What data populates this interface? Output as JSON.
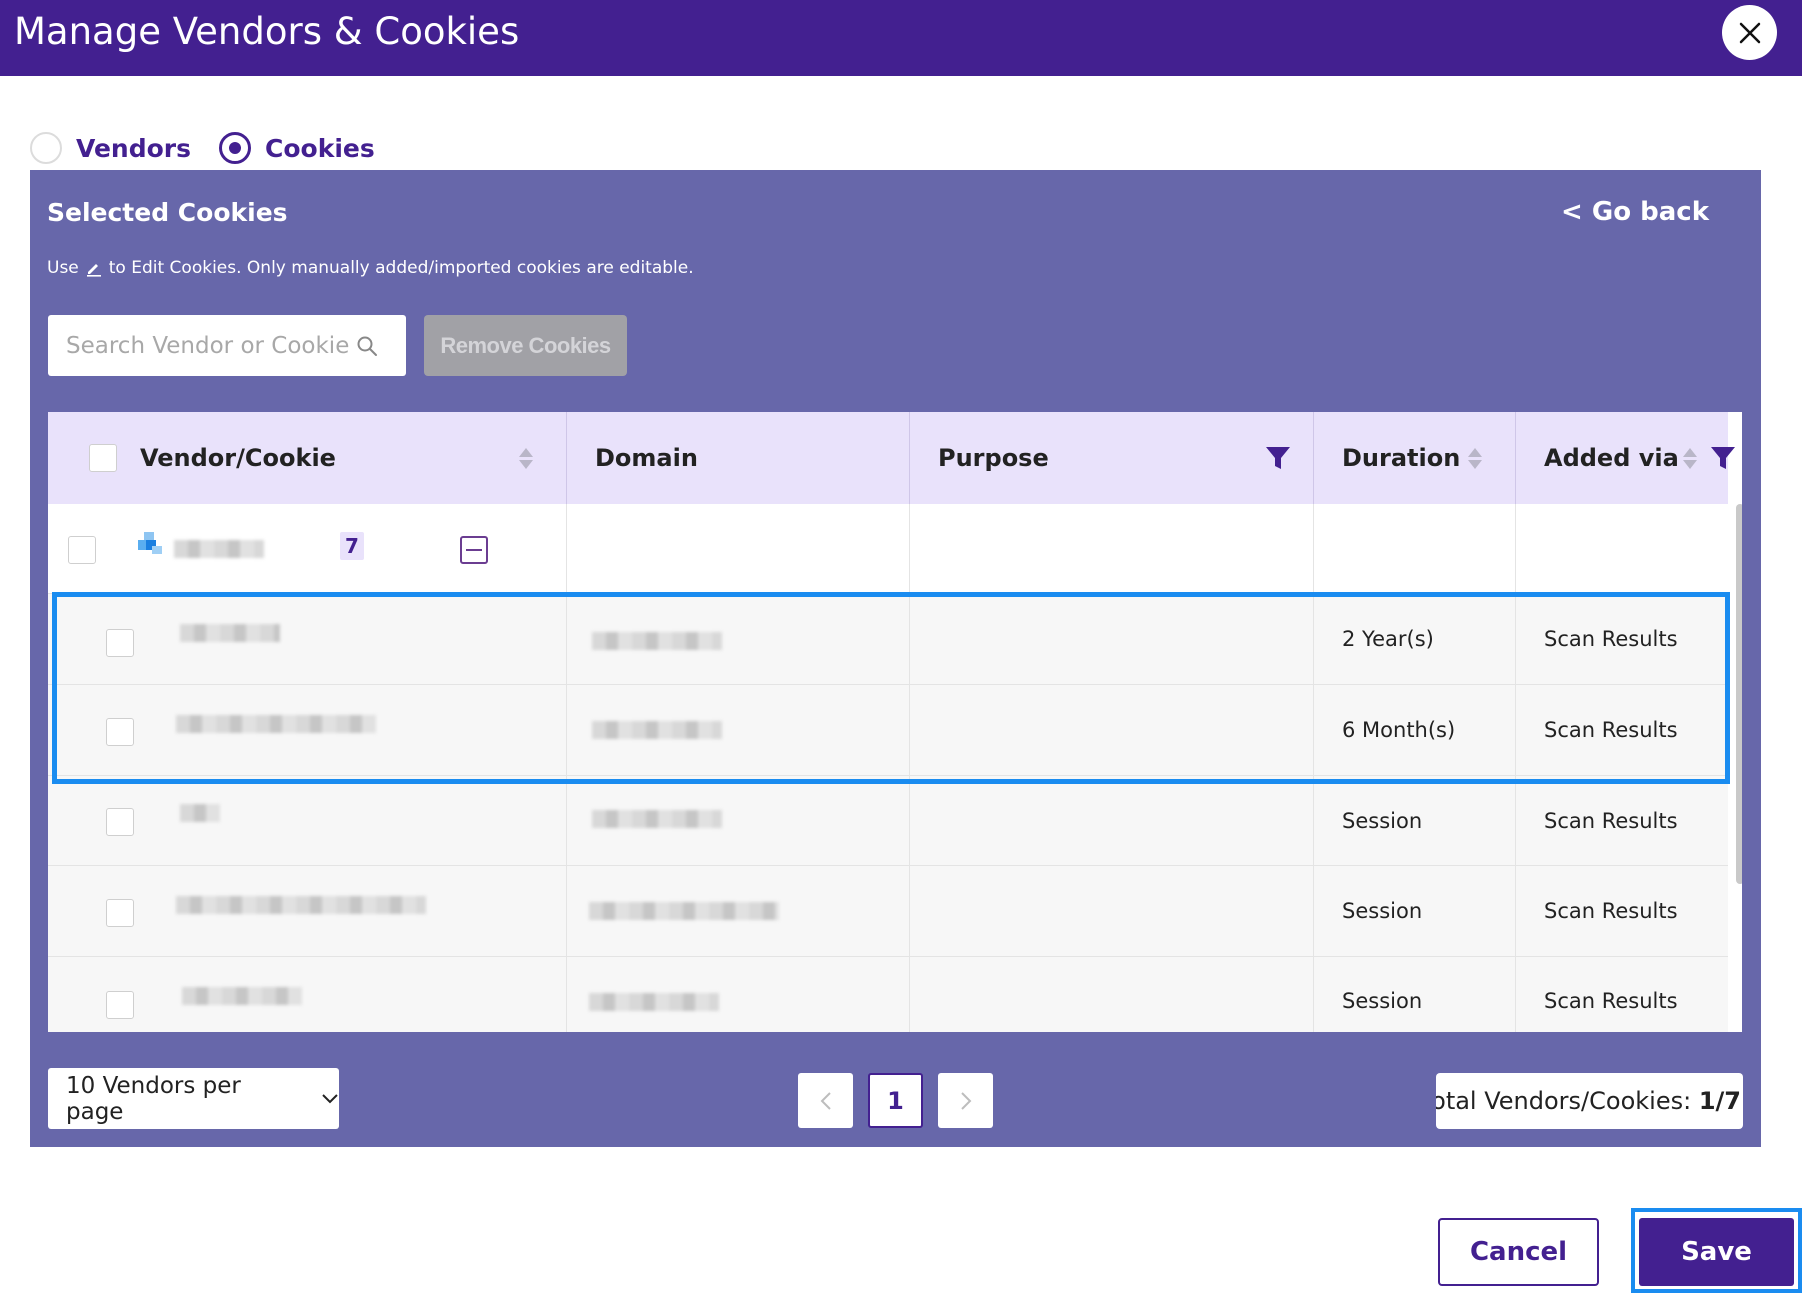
{
  "header": {
    "title": "Manage Vendors & Cookies"
  },
  "tabs": [
    {
      "label": "Vendors",
      "selected": false
    },
    {
      "label": "Cookies",
      "selected": true
    }
  ],
  "panel": {
    "title": "Selected Cookies",
    "go_back": "< Go back",
    "hint_before": "Use",
    "hint_after": "to Edit Cookies. Only manually added/imported cookies are editable.",
    "search_placeholder": "Search Vendor or Cookie",
    "remove_label": "Remove Cookies"
  },
  "table": {
    "columns": [
      "Vendor/Cookie",
      "Domain",
      "Purpose",
      "Duration",
      "Added via"
    ],
    "vendor_group": {
      "count": "7"
    },
    "rows": [
      {
        "duration": "2 Year(s)",
        "added_via": "Scan Results"
      },
      {
        "duration": "6 Month(s)",
        "added_via": "Scan Results"
      },
      {
        "duration": "Session",
        "added_via": "Scan Results"
      },
      {
        "duration": "Session",
        "added_via": "Scan Results"
      },
      {
        "duration": "Session",
        "added_via": "Scan Results"
      }
    ]
  },
  "pagination": {
    "per_page": "10 Vendors per page",
    "current_page": "1",
    "total_label": "Total Vendors/Cookies:",
    "total_value": "1/7"
  },
  "footer": {
    "cancel": "Cancel",
    "save": "Save"
  },
  "colors": {
    "brand": "#432090",
    "panel": "#6767aa",
    "header_row": "#e9e2fb",
    "highlight": "#1a8cf0"
  }
}
